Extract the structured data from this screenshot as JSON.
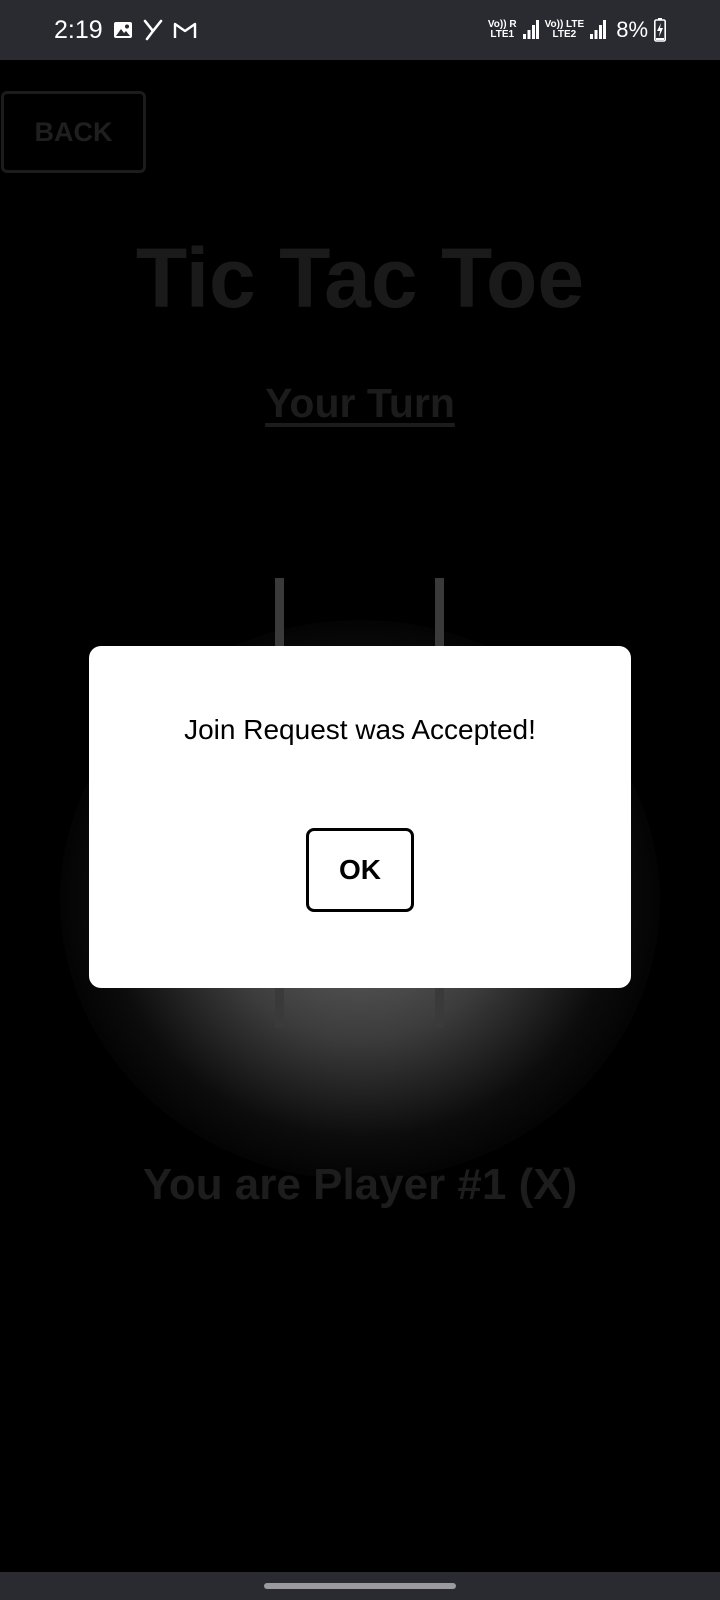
{
  "status_bar": {
    "time": "2:19",
    "icons": [
      "gallery-icon",
      "y-app-icon",
      "gmail-icon"
    ],
    "sim1_top": "Vo)) R",
    "sim1_bottom": "LTE1",
    "sim2_top": "Vo)) LTE",
    "sim2_bottom": "LTE2",
    "battery": "8%"
  },
  "app": {
    "back_label": "BACK",
    "title": "Tic Tac Toe",
    "turn_label": "Your Turn",
    "player_label": "You are Player #1 (X)"
  },
  "dialog": {
    "message": "Join Request was Accepted!",
    "ok_label": "OK"
  }
}
